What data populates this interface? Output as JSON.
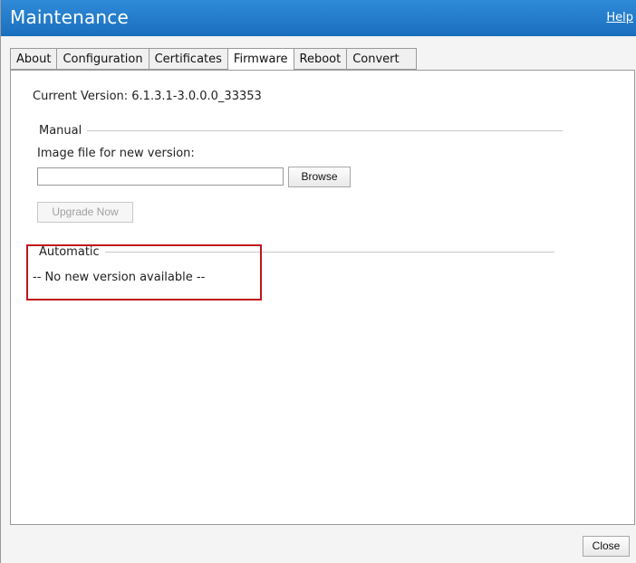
{
  "window": {
    "title": "Maintenance",
    "help_label": "Help"
  },
  "tabs": [
    {
      "label": "About"
    },
    {
      "label": "Configuration"
    },
    {
      "label": "Certificates"
    },
    {
      "label": "Firmware",
      "active": true
    },
    {
      "label": "Reboot"
    },
    {
      "label": "Convert"
    }
  ],
  "firmware": {
    "current_version": "Current Version: 6.1.3.1-3.0.0.0_33353",
    "manual": {
      "legend": "Manual",
      "image_label": "Image file for new version:",
      "file_value": "",
      "browse_label": "Browse",
      "upgrade_label": "Upgrade Now"
    },
    "automatic": {
      "legend": "Automatic",
      "status": "-- No new version available --"
    }
  },
  "footer": {
    "close_label": "Close"
  },
  "colors": {
    "titlebar": "#1f78c8",
    "highlight": "#c0141c"
  }
}
